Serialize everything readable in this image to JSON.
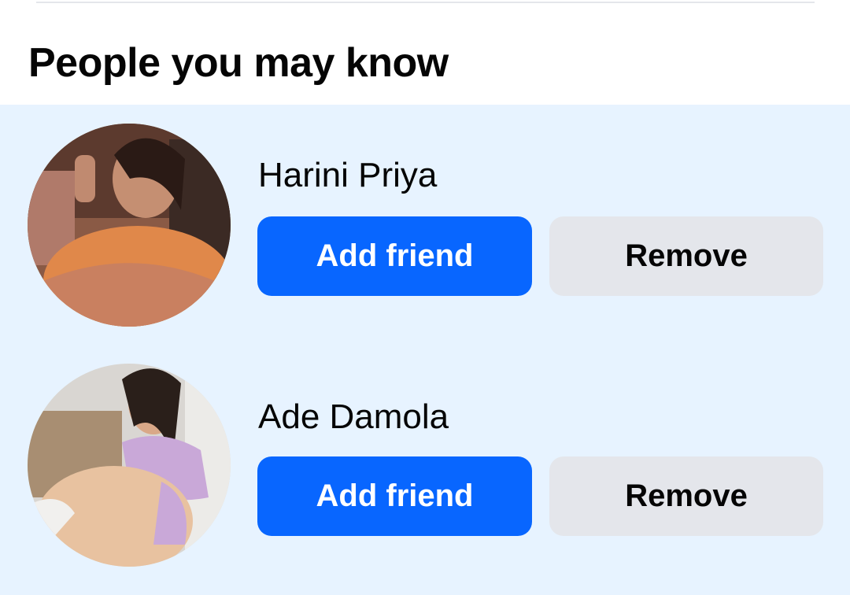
{
  "section": {
    "title": "People you may know"
  },
  "suggestions": [
    {
      "name": "Harini Priya",
      "add_label": "Add friend",
      "remove_label": "Remove"
    },
    {
      "name": "Ade Damola",
      "add_label": "Add friend",
      "remove_label": "Remove"
    }
  ],
  "colors": {
    "primary": "#0866ff",
    "secondary_button": "#e4e6eb",
    "list_background": "#e7f3ff",
    "text": "#050505"
  }
}
